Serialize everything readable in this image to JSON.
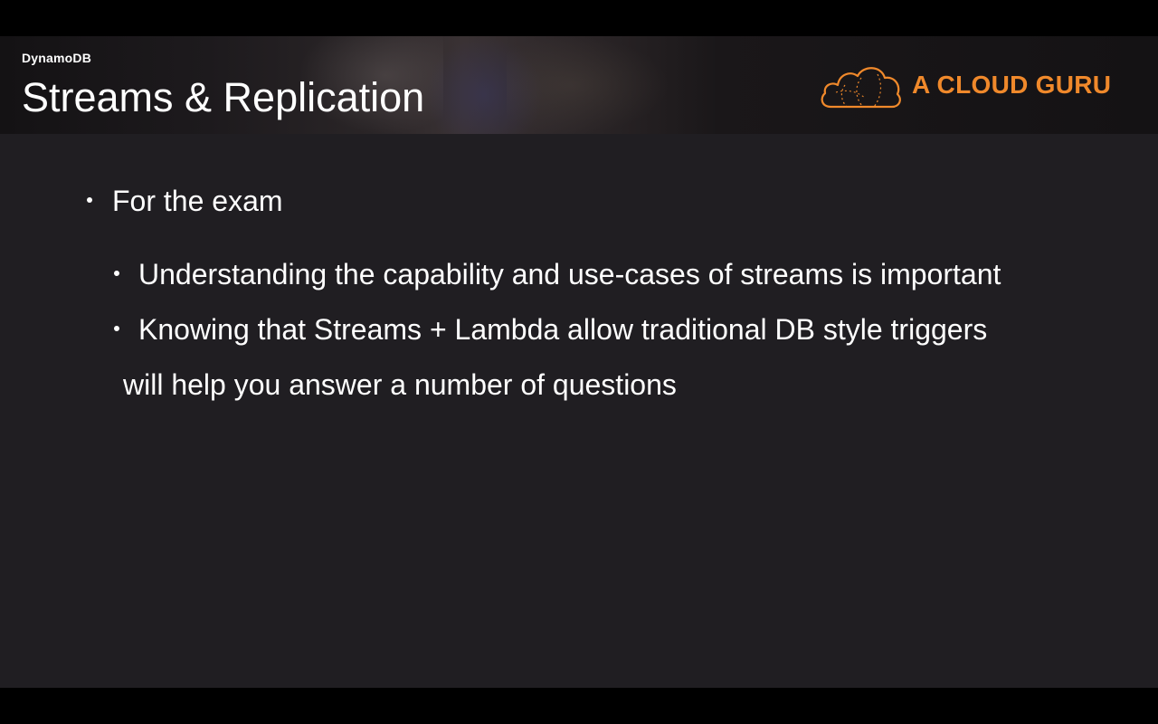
{
  "slide": {
    "section_label": "DynamoDB",
    "title": "Streams & Replication",
    "logo_text": "A CLOUD GURU",
    "logo_icon": "cloud-icon",
    "accent_color": "#f0892b",
    "background_color": "#201e22"
  },
  "bullets": {
    "level1": "For the exam",
    "item1": "Understanding the capability and use-cases of streams is important",
    "item2": "Knowing that Streams + Lambda allow traditional DB style triggers",
    "item2_continuation": "will help you answer a number of questions"
  }
}
